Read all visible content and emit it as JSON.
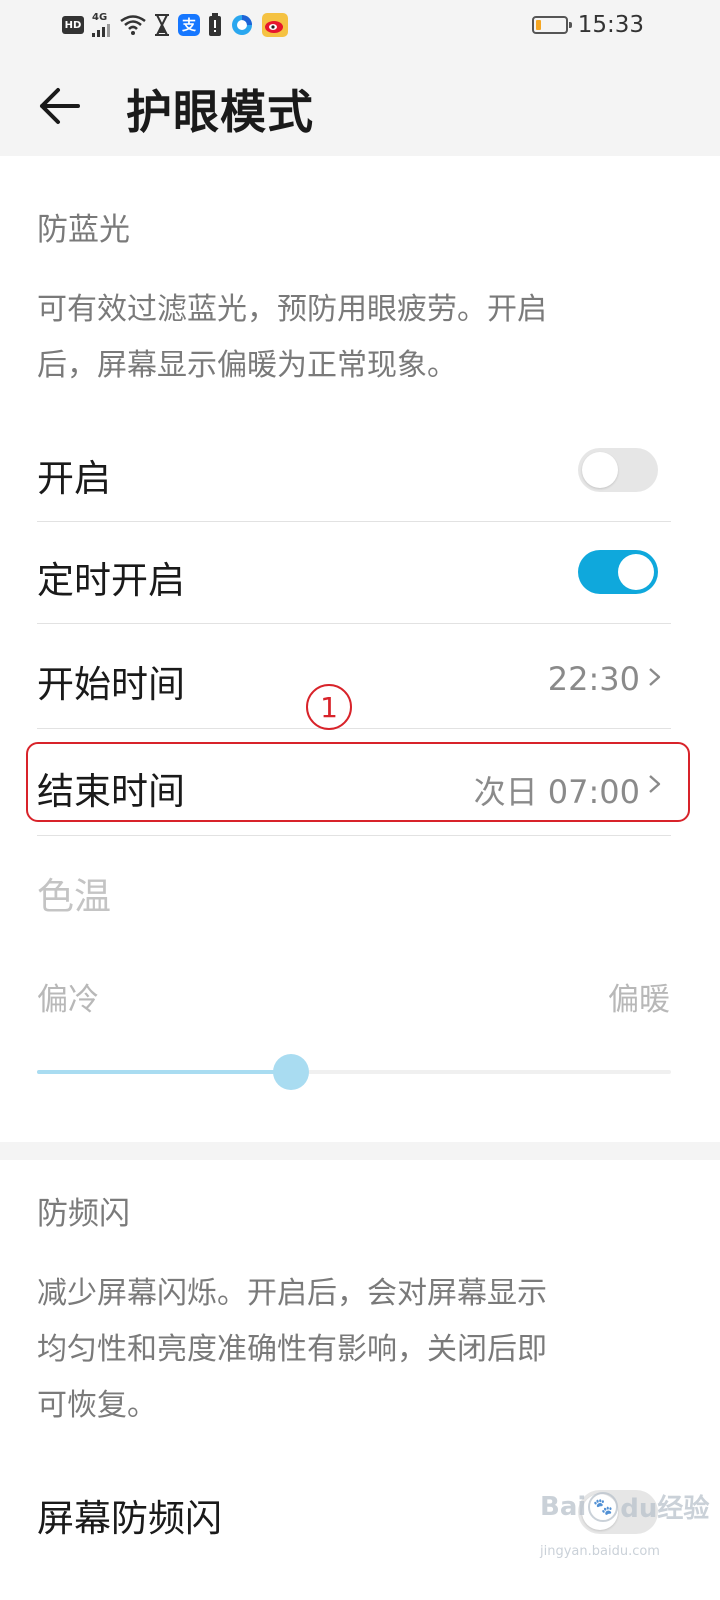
{
  "status_bar": {
    "left_icons": [
      "HD",
      "4G",
      "signal-bars-icon",
      "wifi-icon",
      "hourglass-icon",
      "支",
      "battery-saver-icon",
      "browser-icon",
      "weibo-icon"
    ],
    "hd_label": "HD",
    "net_label": "4G",
    "alipay_label": "支",
    "time": "15:33",
    "battery_level": 0.2,
    "battery_color": "#f5a623"
  },
  "app_bar": {
    "title": "护眼模式",
    "back_icon": "arrow-left-icon"
  },
  "blue_light": {
    "header": "防蓝光",
    "description_line1": "可有效过滤蓝光，预防用眼疲劳。开启",
    "description_line2": "后，屏幕显示偏暖为正常现象。",
    "enable_label": "开启",
    "enable_on": false,
    "schedule_label": "定时开启",
    "schedule_on": true,
    "start_label": "开始时间",
    "start_value": "22:30",
    "end_label": "结束时间",
    "end_value": "次日 07:00",
    "annotation_mark": "1"
  },
  "color_temp": {
    "label": "色温",
    "cold_label": "偏冷",
    "warm_label": "偏暖",
    "level": 0.4,
    "accent": "#0fa8dc"
  },
  "anti_flicker": {
    "header": "防频闪",
    "description_line1": "减少屏幕闪烁。开启后，会对屏幕显示",
    "description_line2": "均匀性和亮度准确性有影响，关闭后即",
    "description_line3": "可恢复。",
    "toggle_label": "屏幕防频闪"
  },
  "watermark": {
    "brand": "Bai",
    "brand_suffix": "du经验",
    "url": "jingyan.baidu.com"
  }
}
